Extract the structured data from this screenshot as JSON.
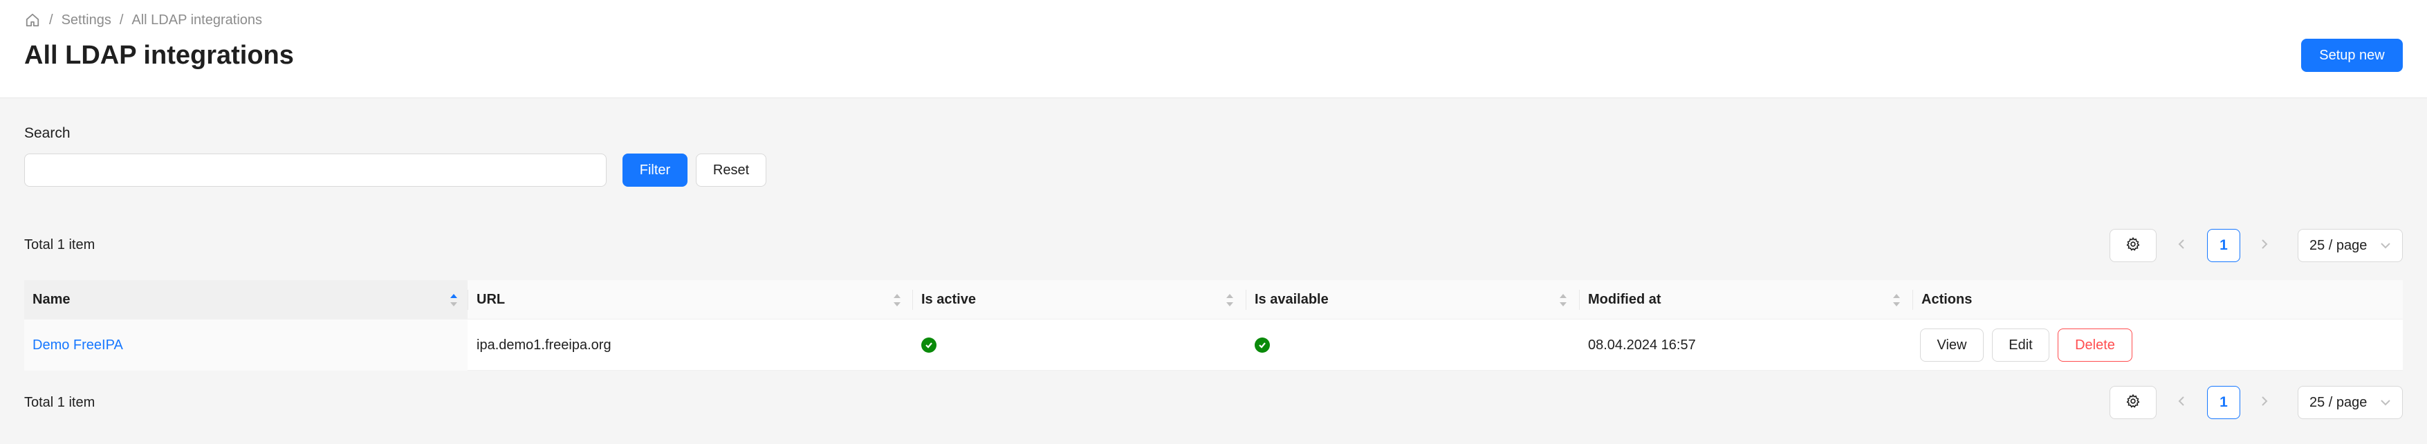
{
  "breadcrumb": {
    "home_icon": "home-icon",
    "separator": "/",
    "items": [
      "Settings",
      "All LDAP integrations"
    ]
  },
  "header": {
    "title": "All LDAP integrations",
    "setup_label": "Setup new"
  },
  "search": {
    "label": "Search",
    "value": "",
    "placeholder": "",
    "filter_label": "Filter",
    "reset_label": "Reset"
  },
  "pagination": {
    "total_text": "Total 1 item",
    "settings_icon": "gear-icon",
    "current_page": "1",
    "page_size": "25 / page"
  },
  "table": {
    "columns": [
      "Name",
      "URL",
      "Is active",
      "Is available",
      "Modified at",
      "Actions"
    ],
    "rows": [
      {
        "name": "Demo FreeIPA",
        "url": "ipa.demo1.freeipa.org",
        "is_active_icon": "check-circle-icon",
        "is_available_icon": "check-circle-icon",
        "modified_at": "08.04.2024 16:57",
        "actions": [
          "View",
          "Edit",
          "Delete"
        ]
      }
    ]
  },
  "colors": {
    "primary": "#1677ff",
    "danger": "#ff4d4f",
    "success": "#0a8a0a",
    "background": "#f5f5f5"
  }
}
